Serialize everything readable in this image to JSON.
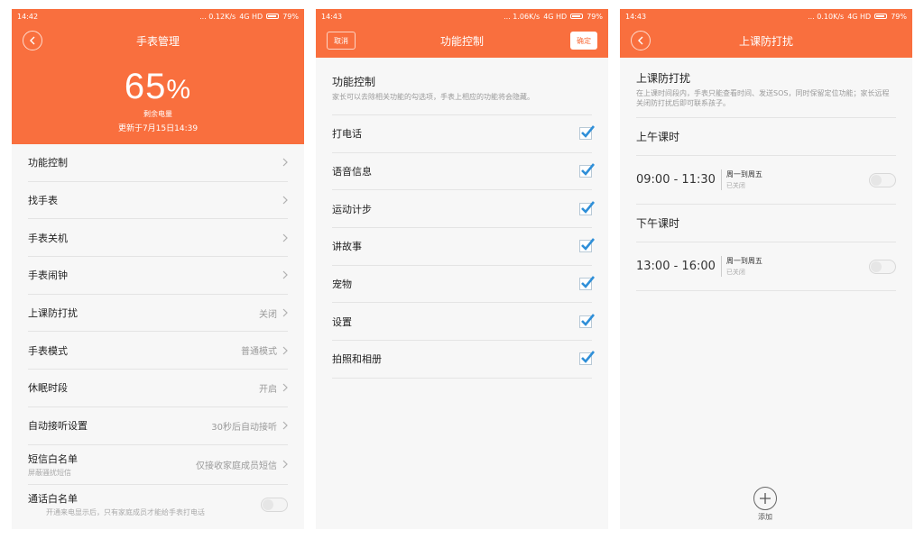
{
  "colors": {
    "accent": "#f96f3e",
    "check": "#2f8fd8"
  },
  "screen1": {
    "status": {
      "time": "14:42",
      "net": "... 0.12K/s",
      "signal": "4G HD",
      "battery": "79%"
    },
    "title": "手表管理",
    "battery_value": "65",
    "battery_unit": "%",
    "battery_label": "剩余电量",
    "updated": "更新于7月15日14:39",
    "rows": [
      {
        "label": "功能控制",
        "value": ""
      },
      {
        "label": "找手表",
        "value": ""
      },
      {
        "label": "手表关机",
        "value": ""
      },
      {
        "label": "手表闹钟",
        "value": ""
      },
      {
        "label": "上课防打扰",
        "value": "关闭"
      },
      {
        "label": "手表模式",
        "value": "普通模式"
      },
      {
        "label": "休眠时段",
        "value": "开启"
      },
      {
        "label": "自动接听设置",
        "value": "30秒后自动接听"
      },
      {
        "label": "短信白名单",
        "sub": "屏蔽骚扰短信",
        "value": "仅接收家庭成员短信"
      },
      {
        "label": "通话白名单",
        "sub": "开通来电显示后，只有家庭成员才能给手表打电话"
      }
    ]
  },
  "screen2": {
    "status": {
      "time": "14:43",
      "net": "... 1.06K/s",
      "signal": "4G HD",
      "battery": "79%"
    },
    "title": "功能控制",
    "cancel": "取消",
    "confirm": "确定",
    "section_title": "功能控制",
    "section_desc": "家长可以去除相关功能的勾选项，手表上相应的功能将会隐藏。",
    "items": [
      {
        "label": "打电话",
        "checked": true
      },
      {
        "label": "语音信息",
        "checked": true
      },
      {
        "label": "运动计步",
        "checked": true
      },
      {
        "label": "讲故事",
        "checked": true
      },
      {
        "label": "宠物",
        "checked": true
      },
      {
        "label": "设置",
        "checked": true
      },
      {
        "label": "拍照和相册",
        "checked": true
      }
    ]
  },
  "screen3": {
    "status": {
      "time": "14:43",
      "net": "... 0.10K/s",
      "signal": "4G HD",
      "battery": "79%"
    },
    "title": "上课防打扰",
    "section_title": "上课防打扰",
    "section_desc": "在上课时间段内，手表只能查看时间、发送SOS，同时保留定位功能；家长远程关闭防打扰后即可联系孩子。",
    "morning": {
      "label": "上午课时",
      "time": "09:00  -  11:30",
      "days": "周一到周五",
      "state": "已关闭"
    },
    "afternoon": {
      "label": "下午课时",
      "time": "13:00  -  16:00",
      "days": "周一到周五",
      "state": "已关闭"
    },
    "add_label": "添加"
  }
}
